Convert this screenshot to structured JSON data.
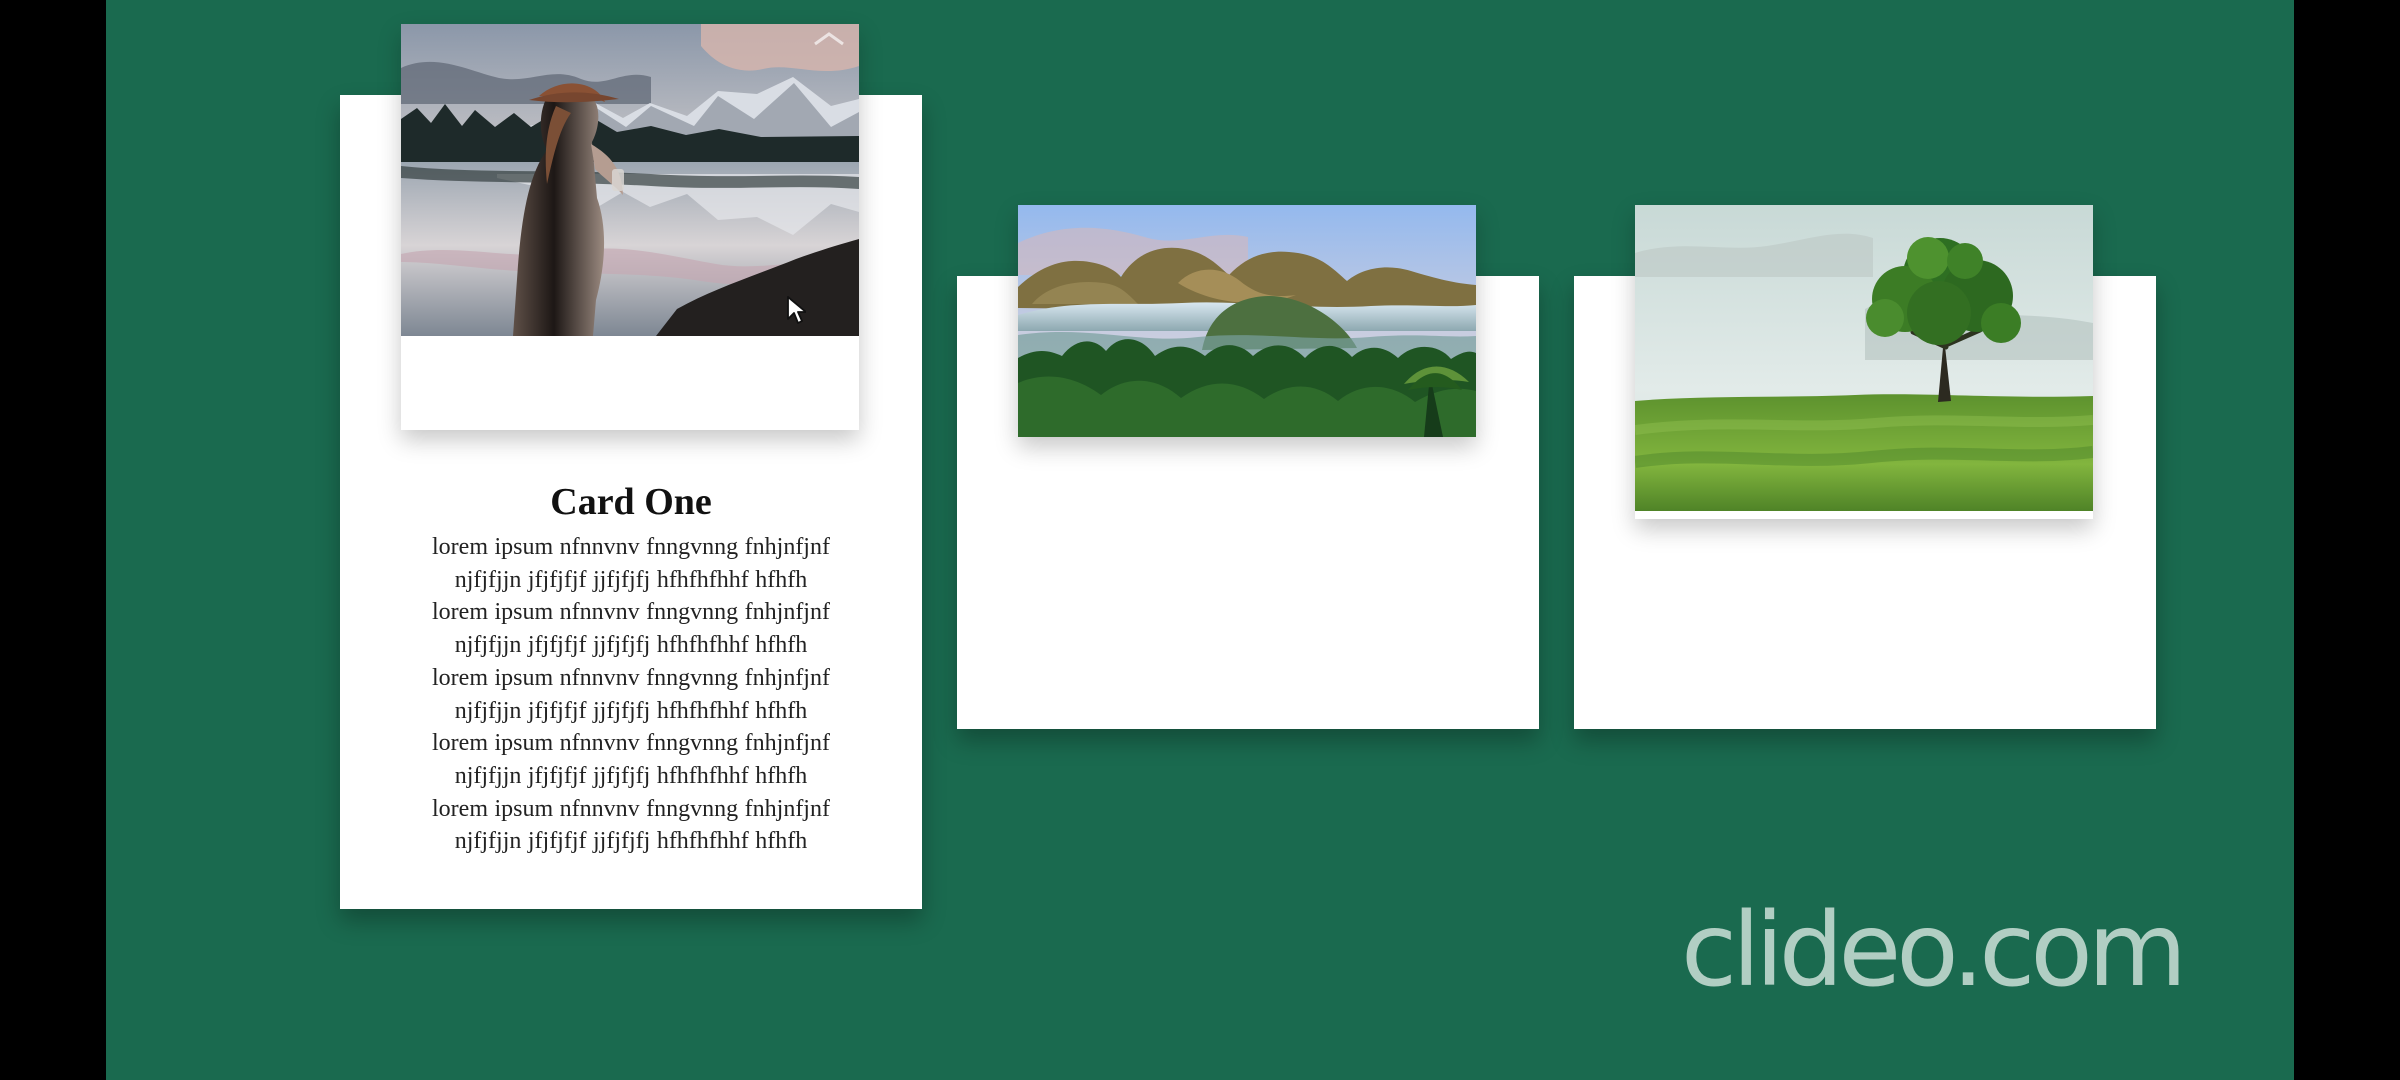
{
  "cards": [
    {
      "title": "Card One",
      "body": "lorem ipsum nfnnvnv fnngvnng fnhjnfjnf\nnjfjfjjn jfjfjfjf jjfjfjfj hfhfhfhhf hfhfh\nlorem ipsum nfnnvnv fnngvnng fnhjnfjnf\nnjfjfjjn jfjfjfjf jjfjfjfj hfhfhfhhf hfhfh\nlorem ipsum nfnnvnv fnngvnng fnhjnfjnf\nnjfjfjjn jfjfjfjf jjfjfjfj hfhfhfhhf hfhfh\nlorem ipsum nfnnvnv fnngvnng fnhjnfjnf\nnjfjfjjn jfjfjfjf jjfjfjfj hfhfhfhhf hfhfh\nlorem ipsum nfnnvnv fnngvnng fnhjnfjnf\nnjfjfjjn jfjfjfjf jjfjfjfj hfhfhfhhf hfhfh",
      "image": "woman-mountain-lake"
    },
    {
      "image": "forest-valley"
    },
    {
      "image": "tree-on-grass"
    }
  ],
  "watermark": "clideo.com",
  "colors": {
    "page_background": "#1a6a4f",
    "side_bars": "#000000",
    "card_background": "#ffffff"
  },
  "icons": {
    "cursor": "cursor-icon"
  }
}
